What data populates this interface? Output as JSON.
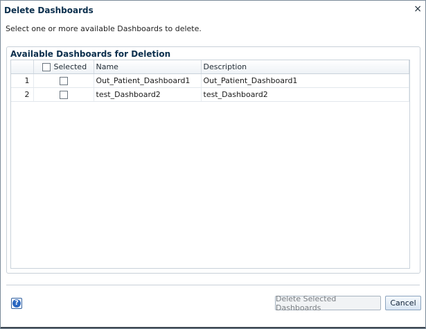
{
  "dialog": {
    "title": "Delete Dashboards",
    "close_glyph": "×",
    "instruction": "Select one or more available Dashboards to delete."
  },
  "panel": {
    "heading": "Available Dashboards for Deletion",
    "columns": {
      "selected": "Selected",
      "name": "Name",
      "description": "Description"
    },
    "rows": [
      {
        "num": "1",
        "selected": false,
        "name": "Out_Patient_Dashboard1",
        "description": "Out_Patient_Dashboard1"
      },
      {
        "num": "2",
        "selected": false,
        "name": "test_Dashboard2",
        "description": "test_Dashboard2"
      }
    ]
  },
  "footer": {
    "help_glyph": "?",
    "delete_label": "Delete Selected Dashboards",
    "cancel_label": "Cancel"
  },
  "colors": {
    "heading": "#0b2f4d",
    "help": "#2b68c1",
    "border": "#c9d2da"
  }
}
